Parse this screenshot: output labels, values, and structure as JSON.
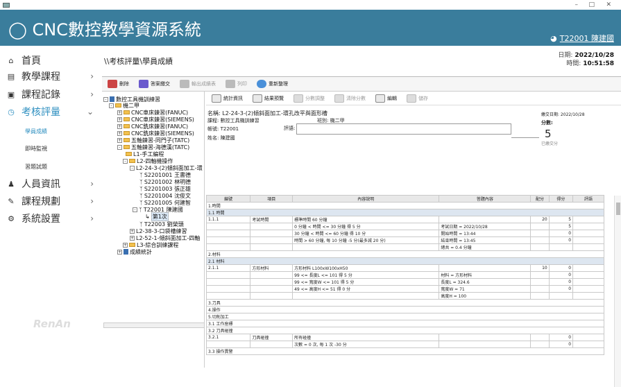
{
  "header": {
    "logo_text": "CNC數控教學資源系統",
    "user_link": "T22001 陳建國"
  },
  "nav": {
    "items": [
      {
        "label": "首頁",
        "icon": "home-icon"
      },
      {
        "label": "教學課程",
        "icon": "book-icon"
      },
      {
        "label": "課程記錄",
        "icon": "record-icon"
      },
      {
        "label": "考核評量",
        "icon": "clock-icon"
      },
      {
        "label": "人員資訊",
        "icon": "person-icon"
      },
      {
        "label": "課程規劃",
        "icon": "pen-icon"
      },
      {
        "label": "系統設置",
        "icon": "gear-icon"
      }
    ],
    "sub_items": [
      "學員成績",
      "即時監視",
      "習題試題"
    ],
    "brand": "RenAn"
  },
  "breadcrumb": "\\\\考核評量\\學員成績",
  "datetime": {
    "date_label": "日期:",
    "date": "2022/10/28",
    "time_label": "時間:",
    "time": "10:51:58"
  },
  "toolbar1": {
    "delete": "刪除",
    "submit": "答案繳交",
    "export": "輸出成績表",
    "print": "列印",
    "refresh": "重新整理"
  },
  "toolbar2": {
    "stats": "統計資訊",
    "preview": "結果預覽",
    "adjust": "分數調整",
    "clear": "清除分數",
    "edit": "編輯",
    "save": "儲存"
  },
  "tree": {
    "root": "數控工具機訓練習",
    "n1": "機二甲",
    "n2": "CNC車床鍊習(FANUC)",
    "n3": "CNC車床鍊習(SIEMENS)",
    "n4": "CNC銑床鍊習(FANUC)",
    "n5": "CNC銑床鍊習(SIEMENS)",
    "n6": "五軸鍊習-同門子(TATC)",
    "n7": "五軸鍊習-海德漢(TATC)",
    "n8": "L1-手工編程",
    "n9": "L2-四軸機操作",
    "n10": "L2-24-3-(2)傾斜面加工-環",
    "s1": "S2201001 王書德",
    "s2": "S2201002 林明德",
    "s3": "S2201003 張正雄",
    "s4": "S2201004 沈俊文",
    "s5": "S2201005 何建智",
    "s6": "T22001 陳建國",
    "s6a": "第1次",
    "s7": "T22003 劉榮頭",
    "n11": "L2-38-3-口袋槽練習",
    "n12": "L2-52-1-傾斜面加工-四軸",
    "n13": "L3-綜合訓練課程",
    "n14": "成績統計"
  },
  "info": {
    "name_label": "名稱: L2-24-3-(2)傾斜面加工-環孔改平與面形槽",
    "course_label": "課程: 數控工具機訓練習",
    "class_label": "班別: 機二甲",
    "id_label": "帳號: T22001",
    "eval_label": "評語:",
    "person_label": "姓名: 陳建國",
    "submit_date": "繳交日期: 2022/10/28",
    "score_label": "分數:",
    "score": "5",
    "pass_status": "已繳交分"
  },
  "table": {
    "headers": [
      "編號",
      "項目",
      "內容說明",
      "答題內容",
      "配分",
      "得分",
      "評語"
    ],
    "rows": [
      {
        "type": "sec",
        "c": [
          "1.時間",
          "",
          "",
          "",
          "",
          "",
          ""
        ]
      },
      {
        "type": "hl",
        "c": [
          "1.1 時間",
          "",
          "",
          "",
          "",
          "",
          ""
        ]
      },
      {
        "type": "row",
        "c": [
          "1.1.1",
          "考試時間",
          "標準時間 60 分鐘",
          "",
          "20",
          "5",
          ""
        ]
      },
      {
        "type": "row",
        "c": [
          "",
          "",
          "0 分鐘 < 時間 <= 30 分鐘 得 5 分",
          "考試日期 = 2022/10/28",
          "",
          "5",
          ""
        ]
      },
      {
        "type": "row",
        "c": [
          "",
          "",
          "30 分鐘 < 時間 <= 60 分鐘 得 10 分",
          "開始時間 = 13:44",
          "",
          "0",
          ""
        ]
      },
      {
        "type": "row",
        "c": [
          "",
          "",
          "時間 > 60 分鐘, 每 10 分鐘 -5 分(最多減 20 分)",
          "結束時間 = 13:45",
          "",
          "0",
          ""
        ]
      },
      {
        "type": "row",
        "c": [
          "",
          "",
          "",
          "總共 = 0.4 分鐘",
          "",
          "",
          ""
        ]
      },
      {
        "type": "sec",
        "c": [
          "2.材料",
          "",
          "",
          "",
          "",
          "",
          ""
        ]
      },
      {
        "type": "hl",
        "c": [
          "2.1 材料",
          "",
          "",
          "",
          "",
          "",
          ""
        ]
      },
      {
        "type": "row",
        "c": [
          "2.1.1",
          "方形材料",
          "方形材料 L100xW100xH50",
          "",
          "10",
          "0",
          ""
        ]
      },
      {
        "type": "row",
        "c": [
          "",
          "",
          "99 <= 長度L <= 101 得 5 分",
          "材料 = 方形材料",
          "",
          "0",
          ""
        ]
      },
      {
        "type": "row",
        "c": [
          "",
          "",
          "99 <= 寬度W <= 101 得 5 分",
          "長度L = 324.6",
          "",
          "0",
          ""
        ]
      },
      {
        "type": "row",
        "c": [
          "",
          "",
          "49 <= 高度H <= 51 得 0 分",
          "寬度W = 71",
          "",
          "0",
          ""
        ]
      },
      {
        "type": "row",
        "c": [
          "",
          "",
          "",
          "高度H = 100",
          "",
          "",
          ""
        ]
      },
      {
        "type": "sec",
        "c": [
          "3.刀具",
          "",
          "",
          "",
          "",
          "",
          ""
        ]
      },
      {
        "type": "sec",
        "c": [
          "4.操作",
          "",
          "",
          "",
          "",
          "",
          ""
        ]
      },
      {
        "type": "sec",
        "c": [
          "5.切削加工",
          "",
          "",
          "",
          "",
          "",
          ""
        ]
      },
      {
        "type": "sec",
        "c": [
          "3.1 工作座標",
          "",
          "",
          "",
          "",
          "",
          ""
        ]
      },
      {
        "type": "sec",
        "c": [
          "3.2 刀具碰撞",
          "",
          "",
          "",
          "",
          "",
          ""
        ]
      },
      {
        "type": "row",
        "c": [
          "3.2.1",
          "刀具碰撞",
          "所有碰撞",
          "",
          "",
          "0",
          ""
        ]
      },
      {
        "type": "row",
        "c": [
          "",
          "",
          "次數 = 0 次, 每 1 次 -30 分",
          "",
          "",
          "0",
          ""
        ]
      },
      {
        "type": "sec",
        "c": [
          "3.3 操作異警",
          "",
          "",
          "",
          "",
          "",
          ""
        ]
      }
    ]
  }
}
